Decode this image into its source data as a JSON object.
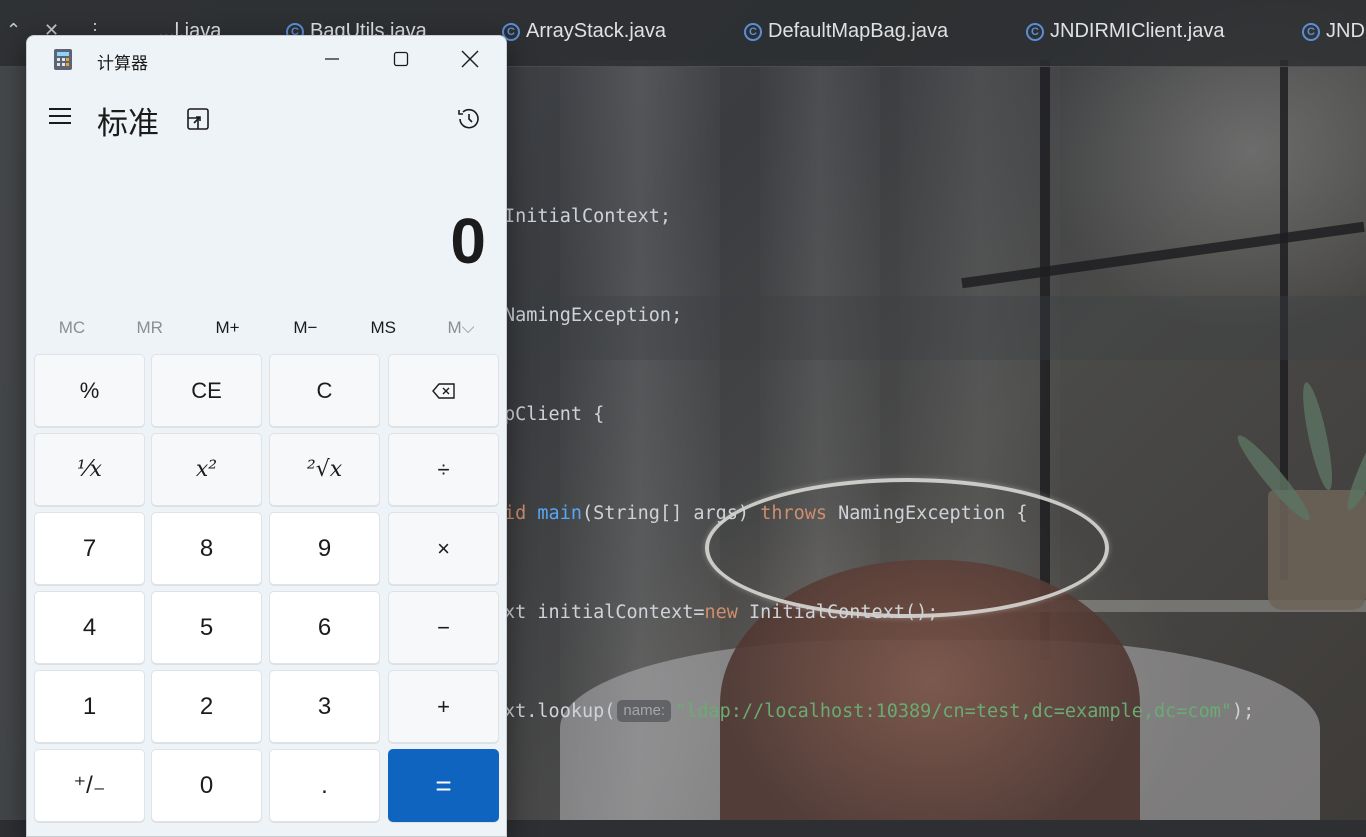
{
  "ide": {
    "tabs": [
      {
        "label": "...l.java"
      },
      {
        "label": "BagUtils.java"
      },
      {
        "label": "ArrayStack.java"
      },
      {
        "label": "DefaultMapBag.java"
      },
      {
        "label": "JNDIRMIClient.java"
      },
      {
        "label": "JND"
      }
    ],
    "code_lines": {
      "l1": "InitialContext;",
      "l2": "NamingException;",
      "l3": "pClient {",
      "l4_a": "id ",
      "l4_b": "main",
      "l4_c": "(String[] args) ",
      "l4_d": "throws",
      "l4_e": " NamingException {",
      "l5_a": "xt initialContext=",
      "l5_b": "new",
      "l5_c": " InitialContext();",
      "l6_a": "xt.lookup(",
      "l6_hint": "name:",
      "l6_str": "\"ldap://localhost:10389/cn=test,dc=example,dc=com\"",
      "l6_end": ");"
    }
  },
  "calculator": {
    "window_title": "计算器",
    "mode": "标准",
    "display": "0",
    "memory": [
      {
        "label": "MC",
        "enabled": false
      },
      {
        "label": "MR",
        "enabled": false
      },
      {
        "label": "M+",
        "enabled": true
      },
      {
        "label": "M−",
        "enabled": true
      },
      {
        "label": "MS",
        "enabled": true
      },
      {
        "label": "M⌵",
        "enabled": false
      }
    ],
    "keys": {
      "percent": "%",
      "ce": "CE",
      "c": "C",
      "backspace": "⌫",
      "reciprocal": "¹⁄x",
      "square": "x²",
      "sqrt": "²√x",
      "divide": "÷",
      "n7": "7",
      "n8": "8",
      "n9": "9",
      "multiply": "×",
      "n4": "4",
      "n5": "5",
      "n6": "6",
      "minus": "−",
      "n1": "1",
      "n2": "2",
      "n3": "3",
      "plus": "+",
      "negate": "⁺/₋",
      "n0": "0",
      "decimal": ".",
      "equals": "="
    },
    "accent_color": "#0f64c0"
  }
}
